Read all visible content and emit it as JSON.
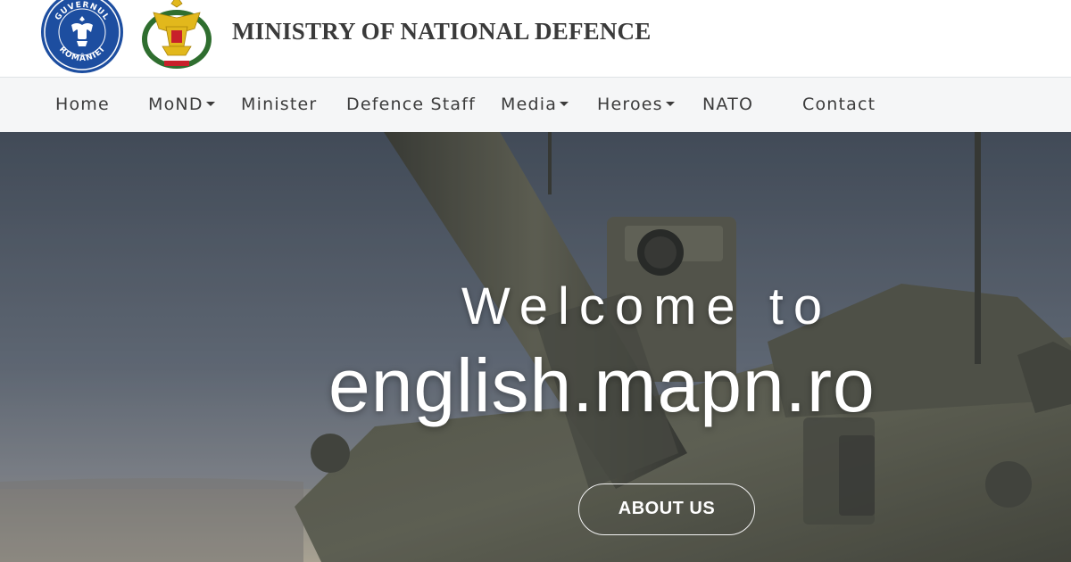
{
  "header": {
    "seal_text_top": "GUVERNUL",
    "seal_text_bottom": "ROMÂNIEI",
    "title": "MINISTRY OF NATIONAL DEFENCE"
  },
  "nav": {
    "items": [
      {
        "label": "Home"
      },
      {
        "label": "MoND",
        "dropdown": true
      },
      {
        "label": "Minister"
      },
      {
        "label": "Defence Staff"
      },
      {
        "label": "Media",
        "dropdown": true
      },
      {
        "label": "Heroes",
        "dropdown": true
      },
      {
        "label": "NATO"
      },
      {
        "label": "Contact"
      }
    ]
  },
  "hero": {
    "welcome": "Welcome to",
    "site_name": "english.mapn.ro",
    "button_label": "ABOUT US"
  },
  "colors": {
    "title_text": "#3a3a3a",
    "nav_bg": "#f5f6f7",
    "seal_blue": "#1d4ea0",
    "crest_gold": "#e2b81c",
    "crest_green": "#2f6e2f"
  }
}
